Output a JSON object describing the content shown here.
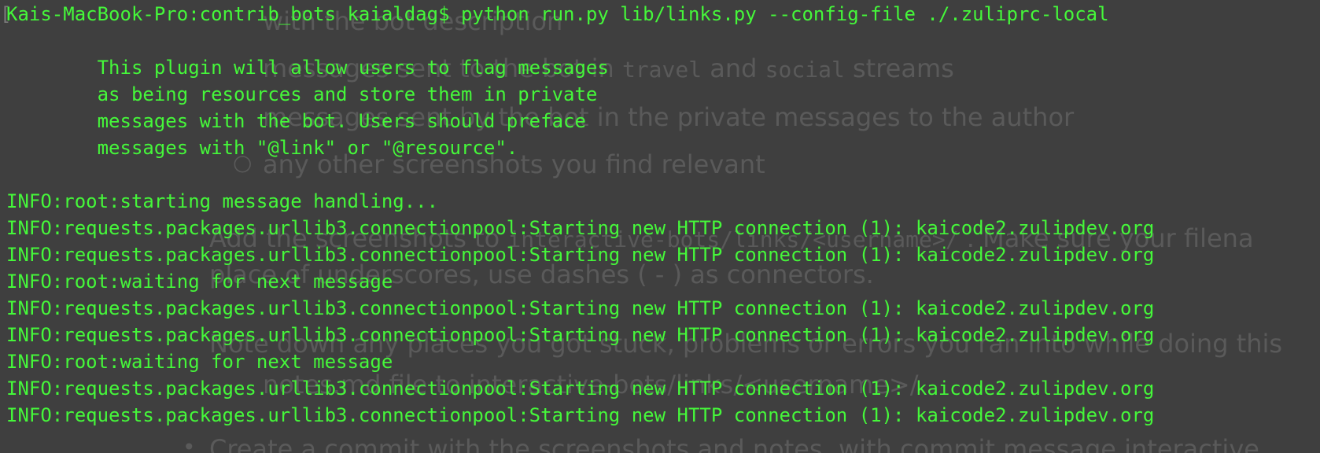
{
  "background_doc": {
    "lines": [
      "with the bot description",
      "messages sent to the bot in",
      "travel",
      "and",
      "social",
      "streams",
      "messages sent by the bot in the private messages to the author",
      "any other screenshots you find relevant",
      "Add the screenshots to",
      "interactive-bots/links/<username>/",
      ". Make sure your filena",
      "place of underscores, use dashes ( - ) as connectors.",
      "Note down any places you got stuck, problems or errors you ran into while doing this",
      "notes.md file to interactive-bots/links/<username>/",
      "Create a commit with the screenshots and notes, with commit message  interactive"
    ]
  },
  "terminal": {
    "bracket": "[",
    "lines": [
      "Kais-MacBook-Pro:contrib_bots kaialdag$ python run.py lib/links.py --config-file ./.zuliprc-local",
      "",
      "        This plugin will allow users to flag messages",
      "        as being resources and store them in private",
      "        messages with the bot. Users should preface",
      "        messages with \"@link\" or \"@resource\".",
      "",
      "INFO:root:starting message handling...",
      "INFO:requests.packages.urllib3.connectionpool:Starting new HTTP connection (1): kaicode2.zulipdev.org",
      "INFO:requests.packages.urllib3.connectionpool:Starting new HTTP connection (1): kaicode2.zulipdev.org",
      "INFO:root:waiting for next message",
      "INFO:requests.packages.urllib3.connectionpool:Starting new HTTP connection (1): kaicode2.zulipdev.org",
      "INFO:requests.packages.urllib3.connectionpool:Starting new HTTP connection (1): kaicode2.zulipdev.org",
      "INFO:root:waiting for next message",
      "INFO:requests.packages.urllib3.connectionpool:Starting new HTTP connection (1): kaicode2.zulipdev.org",
      "INFO:requests.packages.urllib3.connectionpool:Starting new HTTP connection (1): kaicode2.zulipdev.org"
    ]
  },
  "colors": {
    "terminal_text": "#45f73a",
    "terminal_bg": "#3f3f3f",
    "background_text": "#5a5a5a"
  }
}
